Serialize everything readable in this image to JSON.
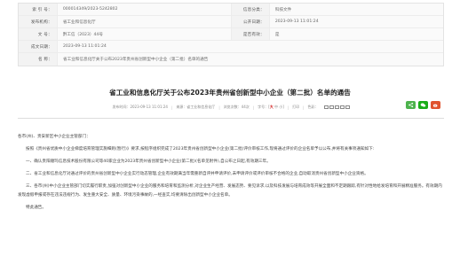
{
  "meta": {
    "index_label": "索 引 号：",
    "index_value": "000014349/2023-5242802",
    "info_class_label": "信息分类：",
    "info_class_value": "科技文件",
    "issuer_label": "发布机构：",
    "issuer_value": "省工业和信息化厅",
    "publish_date_label": "公开日期：",
    "publish_date_value": "2023-09-13 11:01:24",
    "doc_no_label": "文 号：",
    "doc_no_value": "黔工信（2023）44号",
    "valid_label": "是否有效：",
    "valid_value": "是",
    "created_label": "成文日期：",
    "created_value": "2023-09-13 11:01:24",
    "name_label": "名 称：",
    "name_value": "省工业和信息化厅关于公布2023年贵州省创新型中小企业（第二批）名单的通告"
  },
  "title": "省工业和信息化厅关于公布2023年贵州省创新型中小企业（第二批）名单的通告",
  "info_bar": {
    "date": "发布时间：2023-09-13 11:01:24",
    "source": "来源：省工业和信息化厅",
    "views": "浏览次数：44次",
    "font_prefix": "字号：[",
    "font_large": "大",
    "font_mid": "中",
    "font_small": "小",
    "font_suffix": "]",
    "print": "打印",
    "color_label": "色彩："
  },
  "body": {
    "greeting": "各市(州)、贵安新区中小企业主管部门：",
    "p1": "按照《贵州省优质中小企业梯度培育管理实施细则(暂行)》要求,按程序组织完成了2023年贵州省创新型中小企业(第二批)评价审核工作,现将通过评价的企业名单予以公布,并将有关事项通知如下:",
    "p2": "一、确认贵阳顺玛信息技术股份有限公司等40家企业为2023年贵州省创新型中小企业(第二批)(名单见附件),自公布之日起,有效期三年。",
    "p3": "二、省工业和信息化厅对通过评价的贵州省创新型中小企业实行动态管理,企业有效期满当年需重新自评并申请评价,未申请评价或评价审核不合格的企业,自动取消贵州省创新型中小企业资格。",
    "p4": "三、各市(州)中小企业主管部门切实履行职责,加强对创新型中小企业的服务和培育和监测分析,对企业生产经营、发展态势、要见诉求,以及科技发展与培育成效等开展全面和不定期跟踪,有针对性地给发培育和开展精准服务。有效期内发现虚假申报或存在违法违规行为、发生重大安全、质量、环境污染事故的,一经查实,均要清除出创新型中小企业名单。",
    "closing": "特此通告。"
  }
}
